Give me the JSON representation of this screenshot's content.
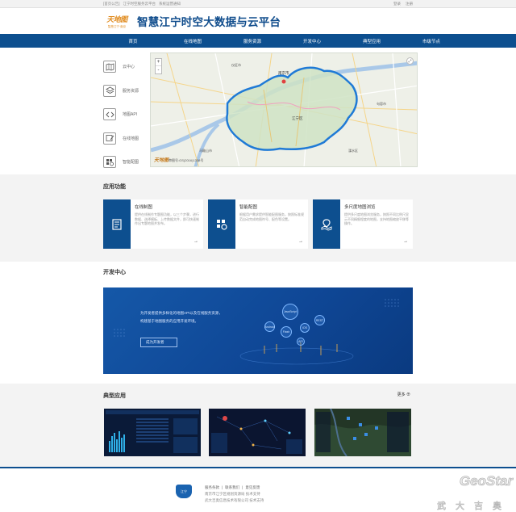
{
  "topbar": {
    "left_links": [
      "[首页公告]",
      "江宁时空服务云平台",
      "系统运营通知"
    ],
    "right_links": [
      "登录",
      "注册"
    ]
  },
  "header": {
    "logo_mark": "天地图",
    "logo_sub": "智慧江宁·南京",
    "title": "智慧江宁时空大数据与云平台"
  },
  "nav": {
    "items": [
      "首页",
      "在线地图",
      "服务资源",
      "开发中心",
      "典型应用",
      "市级节点"
    ]
  },
  "sidebar": {
    "items": [
      {
        "label": "云中心",
        "icon": "map-icon"
      },
      {
        "label": "服务资源",
        "icon": "layers-icon"
      },
      {
        "label": "地图API",
        "icon": "code-icon"
      },
      {
        "label": "在线地图",
        "icon": "map-edit-icon"
      },
      {
        "label": "智能配图",
        "icon": "grid-gear-icon"
      }
    ]
  },
  "map": {
    "zoom_in": "+",
    "zoom_out": "-",
    "fullscreen": "⤢",
    "watermark": "天地图",
    "attribution": "审图号:GS(2016)1338号",
    "place_labels": [
      "南京市",
      "江宁区",
      "溧水区",
      "马鞍山市",
      "句容市",
      "仪征市"
    ]
  },
  "apps_section": {
    "title": "应用功能",
    "cards": [
      {
        "title": "在线制图",
        "desc": "提供在线制作专题图功能，以三个步骤，进行数据、选择模板、上传数据文件，即可快速制作出专题地图并发布。",
        "arrow": "→",
        "icon": "document-icon"
      },
      {
        "title": "智能配图",
        "desc": "根据用户需求提供智能配图服务，按照标准规范自动完成地图符号、配色等设置。",
        "arrow": "→",
        "icon": "grid-gear-icon"
      },
      {
        "title": "多尺度地图浏览",
        "desc": "提供多尺度地图浏览服务，按照不同比例尺显示不同精细程度的地图，支持地图缩放平移等操作。",
        "arrow": "→",
        "icon": "map-pin-icon"
      }
    ]
  },
  "dev_section": {
    "title": "开发中心",
    "line1": "为开发者提供多样化的地图API以及在线服务资源，",
    "line2": "构建基于地图服务的应用开发环境。",
    "button": "成为开发者",
    "bubbles": [
      "JavaScript",
      "Android",
      "iOS",
      "Flash",
      "REST",
      "API"
    ]
  },
  "typical_section": {
    "title": "典型应用",
    "more": "更多"
  },
  "footer": {
    "badge": "江宁",
    "links": [
      "服务条款",
      "联系我们",
      "意见反馈"
    ],
    "line2": "南京市江宁区规划资源局 技术支持",
    "line3": "武大吉奥信息技术有限公司 技术支持"
  },
  "brand": {
    "name": "GeoStar",
    "cn": "武大吉奥"
  },
  "colors": {
    "primary": "#0d4f8f",
    "accent": "#e08a1c",
    "banner": "#1558a8"
  }
}
